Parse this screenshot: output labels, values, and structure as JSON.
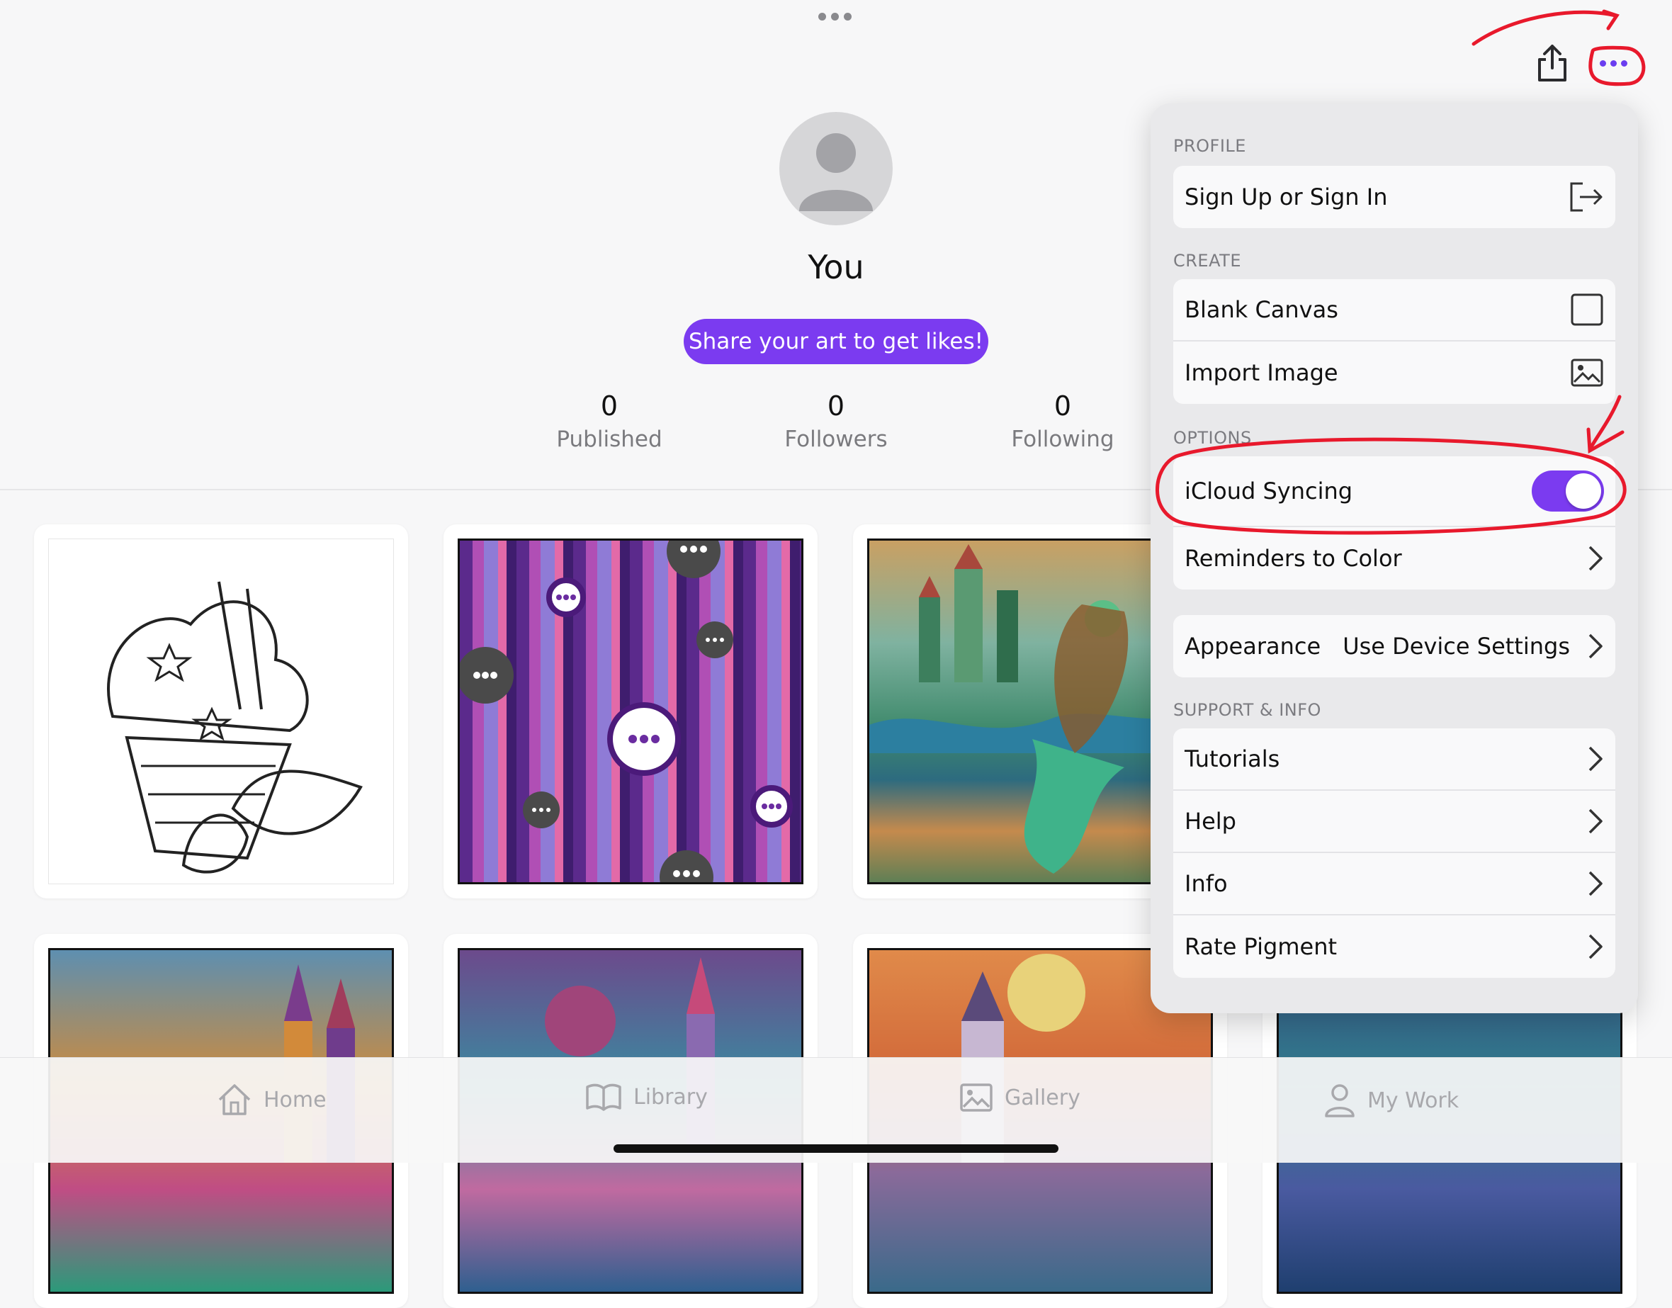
{
  "profile": {
    "name": "You",
    "share_prompt": "Share your art to get likes!",
    "stats": [
      {
        "value": "0",
        "label": "Published"
      },
      {
        "value": "0",
        "label": "Followers"
      },
      {
        "value": "0",
        "label": "Following"
      }
    ]
  },
  "tabs": [
    {
      "label": "Home",
      "icon": "house-icon"
    },
    {
      "label": "Library",
      "icon": "book-icon"
    },
    {
      "label": "Gallery",
      "icon": "photo-icon"
    },
    {
      "label": "My Work",
      "icon": "person-icon"
    }
  ],
  "menu": {
    "profile_header": "PROFILE",
    "sign_in": "Sign Up or Sign In",
    "create_header": "CREATE",
    "blank_canvas": "Blank Canvas",
    "import_image": "Import Image",
    "options_header": "OPTIONS",
    "icloud_syncing": "iCloud Syncing",
    "icloud_on": true,
    "reminders": "Reminders to Color",
    "appearance": "Appearance",
    "appearance_value": "Use Device Settings",
    "support_header": "SUPPORT & INFO",
    "tutorials": "Tutorials",
    "help": "Help",
    "info": "Info",
    "rate": "Rate Pigment"
  },
  "colors": {
    "accent": "#7b3bf0",
    "annotation": "#e8192c"
  }
}
